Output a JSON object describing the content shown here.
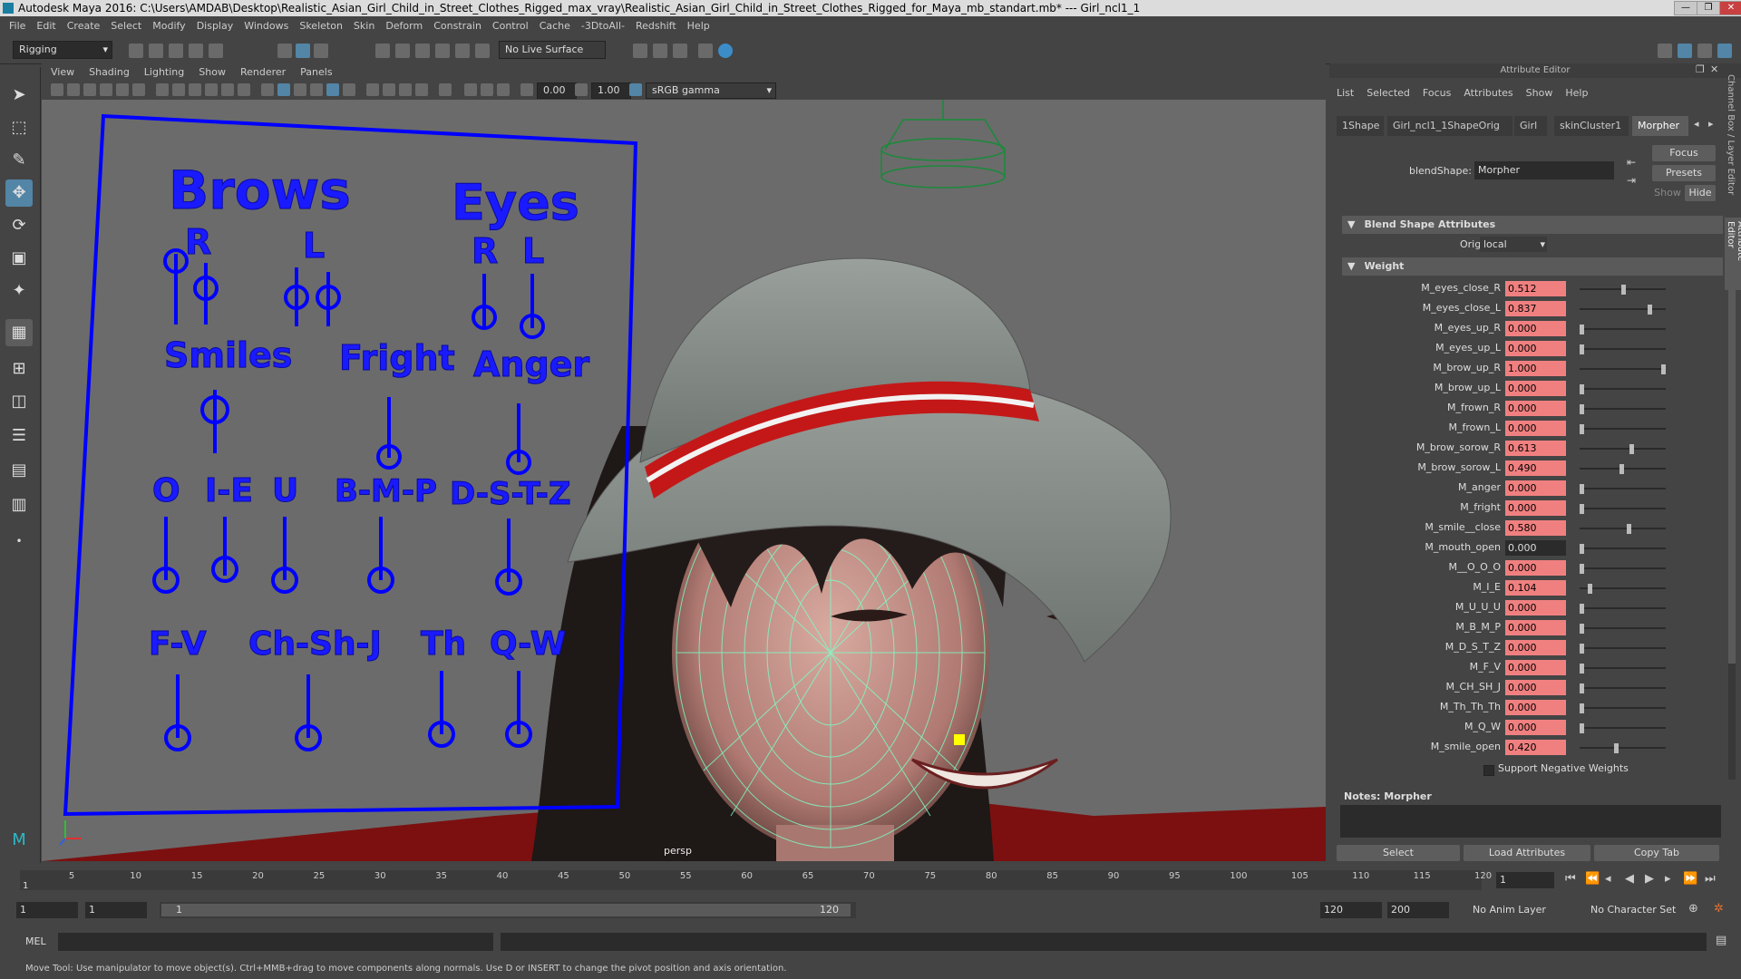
{
  "window": {
    "title": "Autodesk Maya 2016: C:\\Users\\AMDAB\\Desktop\\Realistic_Asian_Girl_Child_in_Street_Clothes_Rigged_max_vray\\Realistic_Asian_Girl_Child_in_Street_Clothes_Rigged_for_Maya_mb_standart.mb*   ---   Girl_ncl1_1",
    "controls": [
      "—",
      "❐",
      "✕"
    ]
  },
  "menubar": [
    "File",
    "Edit",
    "Create",
    "Select",
    "Modify",
    "Display",
    "Windows",
    "Skeleton",
    "Skin",
    "Deform",
    "Constrain",
    "Control",
    "Cache",
    "-3DtoAll-",
    "Redshift",
    "Help"
  ],
  "statusline": {
    "menuset": "Rigging",
    "live_surface": "No Live Surface"
  },
  "viewport": {
    "menu": [
      "View",
      "Shading",
      "Lighting",
      "Show",
      "Renderer",
      "Panels"
    ],
    "exposure": "0.00",
    "gamma": "1.00",
    "colorspace": "sRGB gamma",
    "camera_label": "persp",
    "face_board": {
      "headers": [
        "Brows",
        "Eyes",
        "Smiles",
        "Fright",
        "Anger"
      ],
      "side_labels": [
        "R",
        "L",
        "R",
        "L"
      ],
      "phonemes_row1": [
        "O",
        "I-E",
        "U",
        "B-M-P",
        "D-S-T-Z"
      ],
      "phonemes_row2": [
        "F-V",
        "Ch-Sh-J",
        "Th",
        "Q-W"
      ]
    }
  },
  "attribute_editor": {
    "title": "Attribute Editor",
    "menu": [
      "List",
      "Selected",
      "Focus",
      "Attributes",
      "Show",
      "Help"
    ],
    "tabs": [
      "1Shape",
      "Girl_ncl1_1ShapeOrig",
      "Girl",
      "skinCluster1",
      "Morpher"
    ],
    "selected_tab": "Morpher",
    "blendshape_label": "blendShape:",
    "blendshape_value": "Morpher",
    "buttons": {
      "focus": "Focus",
      "presets": "Presets",
      "show": "Show",
      "hide": "Hide"
    },
    "section_blend": "Blend Shape Attributes",
    "origin_label": "Origin",
    "origin_value": "local",
    "section_weight": "Weight",
    "weights": [
      {
        "name": "M_eyes_close_R",
        "value": "0.512",
        "keyed": true
      },
      {
        "name": "M_eyes_close_L",
        "value": "0.837",
        "keyed": true
      },
      {
        "name": "M_eyes_up_R",
        "value": "0.000",
        "keyed": true
      },
      {
        "name": "M_eyes_up_L",
        "value": "0.000",
        "keyed": true
      },
      {
        "name": "M_brow_up_R",
        "value": "1.000",
        "keyed": true
      },
      {
        "name": "M_brow_up_L",
        "value": "0.000",
        "keyed": true
      },
      {
        "name": "M_frown_R",
        "value": "0.000",
        "keyed": true
      },
      {
        "name": "M_frown_L",
        "value": "0.000",
        "keyed": true
      },
      {
        "name": "M_brow_sorow_R",
        "value": "0.613",
        "keyed": true
      },
      {
        "name": "M_brow_sorow_L",
        "value": "0.490",
        "keyed": true
      },
      {
        "name": "M_anger",
        "value": "0.000",
        "keyed": true
      },
      {
        "name": "M_fright",
        "value": "0.000",
        "keyed": true
      },
      {
        "name": "M_smile__close",
        "value": "0.580",
        "keyed": true
      },
      {
        "name": "M_mouth_open",
        "value": "0.000",
        "keyed": false
      },
      {
        "name": "M__O_O_O",
        "value": "0.000",
        "keyed": true
      },
      {
        "name": "M_I_E",
        "value": "0.104",
        "keyed": true
      },
      {
        "name": "M_U_U_U",
        "value": "0.000",
        "keyed": true
      },
      {
        "name": "M_B_M_P",
        "value": "0.000",
        "keyed": true
      },
      {
        "name": "M_D_S_T_Z",
        "value": "0.000",
        "keyed": true
      },
      {
        "name": "M_F_V",
        "value": "0.000",
        "keyed": true
      },
      {
        "name": "M_CH_SH_J",
        "value": "0.000",
        "keyed": true
      },
      {
        "name": "M_Th_Th_Th",
        "value": "0.000",
        "keyed": true
      },
      {
        "name": "M_Q_W",
        "value": "0.000",
        "keyed": true
      },
      {
        "name": "M_smile_open",
        "value": "0.420",
        "keyed": true
      }
    ],
    "support_negative": "Support Negative Weights",
    "notes_label": "Notes:",
    "notes_value": "Morpher",
    "bottom_buttons": [
      "Select",
      "Load Attributes",
      "Copy Tab"
    ],
    "side_tabs": [
      "Channel Box / Layer Editor",
      "Attribute Editor"
    ]
  },
  "timeline": {
    "ticks": [
      "5",
      "10",
      "15",
      "20",
      "25",
      "30",
      "35",
      "40",
      "45",
      "50",
      "55",
      "60",
      "65",
      "70",
      "75",
      "80",
      "85",
      "90",
      "95",
      "100",
      "105",
      "110",
      "115",
      "120"
    ],
    "start_marker": "1",
    "current_frame": "1"
  },
  "range": {
    "start": "1",
    "playback_start": "1",
    "slider_start": "1",
    "slider_end": "120",
    "playback_end": "120",
    "end": "200",
    "anim_layer": "No Anim Layer",
    "character_set": "No Character Set"
  },
  "command_line": {
    "label": "MEL"
  },
  "help_line": "Move Tool: Use manipulator to move object(s). Ctrl+MMB+drag to move components along normals. Use D or INSERT to change the pivot position and axis orientation."
}
